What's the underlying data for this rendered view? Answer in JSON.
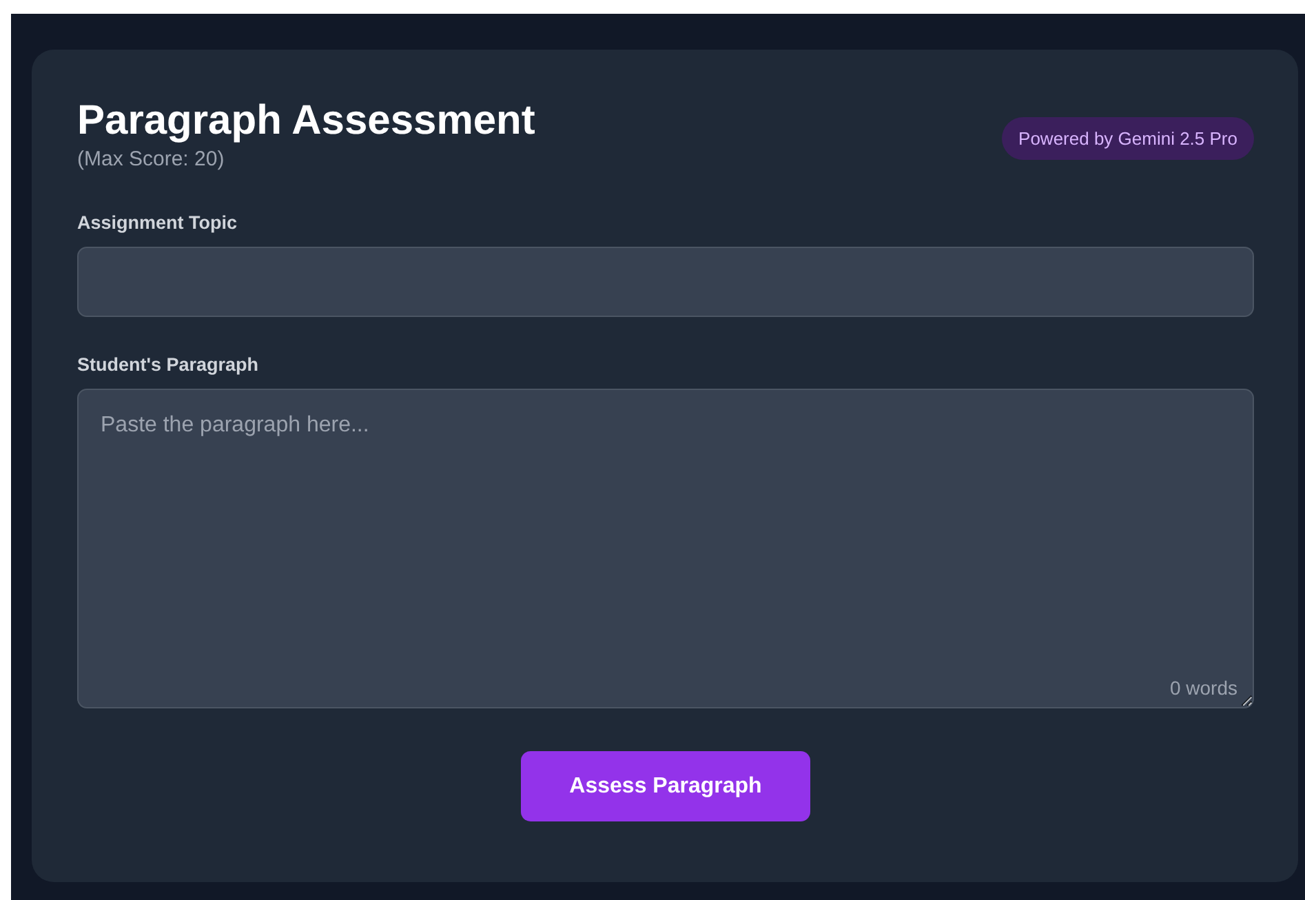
{
  "header": {
    "title": "Paragraph Assessment",
    "subtitle": "(Max Score: 20)",
    "badge": "Powered by Gemini 2.5 Pro"
  },
  "fields": [
    {
      "kind": "input",
      "label": "Assignment Topic"
    },
    {
      "kind": "textarea",
      "label": "Student's Paragraph",
      "placeholder": "Paste the paragraph here...",
      "counter": "0 words"
    }
  ],
  "submit_button": "Assess Paragraph"
}
